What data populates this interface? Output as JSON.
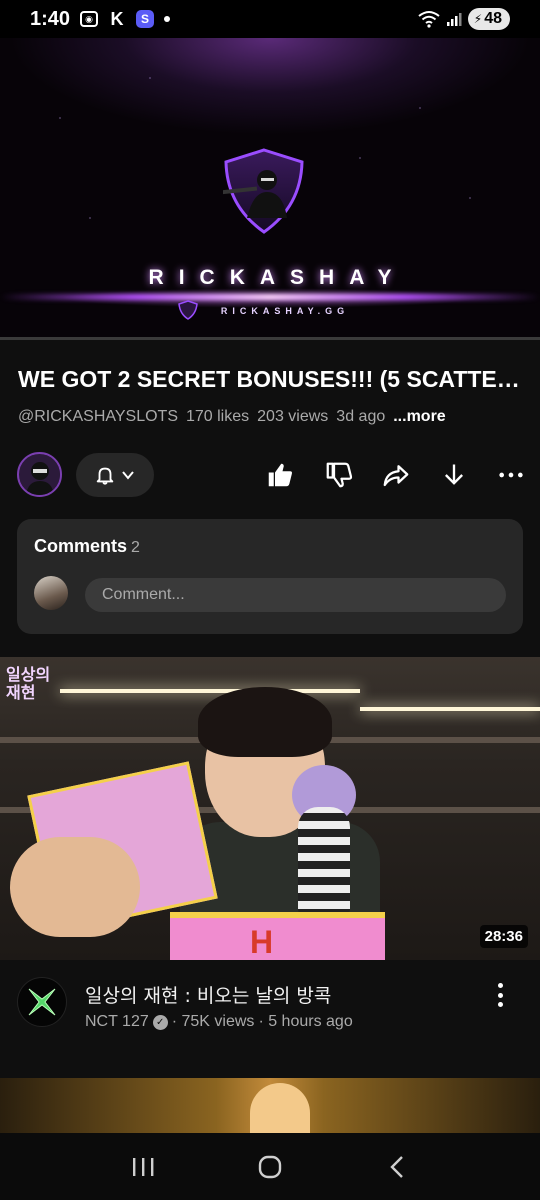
{
  "status_bar": {
    "time": "1:40",
    "battery": "48",
    "icons": [
      "screen-record-icon",
      "k-app-icon",
      "sync-app-icon",
      "notification-dot",
      "wifi-icon",
      "signal-icon",
      "battery-icon"
    ]
  },
  "hero_video": {
    "brand_text": "RICKASHAY",
    "domain_text": "RICKASHAY.GG",
    "progress": 0.0
  },
  "video": {
    "title": "WE GOT 2 SECRET BONUSES!!! (5 SCATTE…",
    "channel_handle": "@RICKASHAYSLOTS",
    "likes": "170 likes",
    "views": "203 views",
    "age": "3d ago",
    "more_label": "...more"
  },
  "actions": {
    "icons": [
      "bell-icon",
      "chevron-down-icon",
      "like-icon",
      "dislike-icon",
      "share-icon",
      "download-icon",
      "more-icon"
    ]
  },
  "comments": {
    "heading": "Comments",
    "count": "2",
    "placeholder": "Comment..."
  },
  "next_video": {
    "title": "일상의 재현 : 비오는 날의 방콕",
    "channel": "NCT 127",
    "views": "· 75K views",
    "age": "· 5 hours ago",
    "duration": "28:36",
    "thumb_logo": "일상의 재현"
  },
  "colors": {
    "background": "#0f0f0f",
    "card": "#272727",
    "secondary_text": "#aaaaaa",
    "accent_purple": "#b651ff"
  }
}
